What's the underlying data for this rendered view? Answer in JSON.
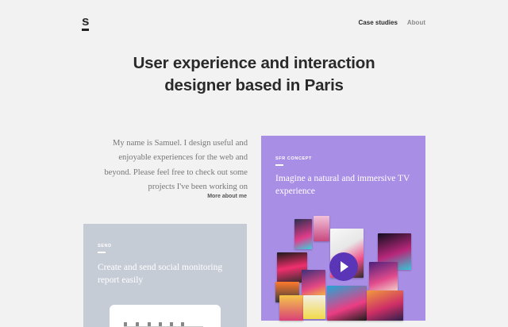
{
  "header": {
    "logo_letter": "s",
    "nav": [
      {
        "label": "Case studies"
      },
      {
        "label": "About"
      }
    ]
  },
  "hero": {
    "line1": "User experience and interaction",
    "line2": "designer based in Paris"
  },
  "intro": {
    "text": "My name is Samuel. I design useful and enjoyable experiences for the web and beyond. Please feel free to check out some projects I've been working on",
    "more_link": "More about me"
  },
  "projects": [
    {
      "kicker": "SFR CONCEPT",
      "title": "Imagine a natural and immersive TV experience",
      "color": "#a98ee6"
    },
    {
      "kicker": "SEND",
      "title": "Create and send social monitoring report easily",
      "color": "#c6ccd6"
    }
  ]
}
